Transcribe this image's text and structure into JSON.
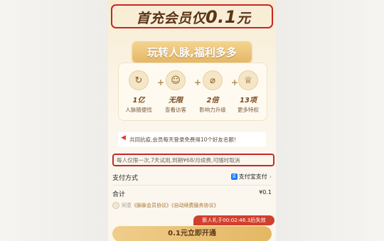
{
  "hero": {
    "title_prefix": "首充会员仅",
    "title_price": "0.1",
    "title_suffix": "元",
    "ribbon": "玩转人脉,福利多多"
  },
  "benefits": [
    {
      "icon": "network-icon",
      "value": "1亿",
      "label": "人脉随便找"
    },
    {
      "icon": "visitors-icon",
      "value": "无限",
      "label": "查看访客"
    },
    {
      "icon": "compass-icon",
      "value": "2倍",
      "label": "影响力升级"
    },
    {
      "icon": "crown-icon",
      "value": "13项",
      "label": "更多特权"
    }
  ],
  "plus_sign": "+",
  "notice": "共同抗疫,会员每天登录免费得10个好友名额!",
  "trial": "每人仅限一次,7天试用,到期¥68/月续费,可随时取消",
  "payment": {
    "label": "支付方式",
    "method": "支付宝支付",
    "alipay_glyph": "支"
  },
  "total": {
    "label": "合计",
    "amount": "¥0.1"
  },
  "agreement": {
    "prefix": "同意",
    "link1": "《脉脉会员协议》",
    "link2": "《自动续费服务协议》"
  },
  "newbie_badge": "新人礼于00:02:46.3后失效",
  "cta": "0.1元立即开通",
  "colors": {
    "highlight_border": "#c8262a",
    "gold_button": "#e4b763",
    "badge_red": "#d23f2d",
    "alipay_blue": "#1677ff"
  }
}
